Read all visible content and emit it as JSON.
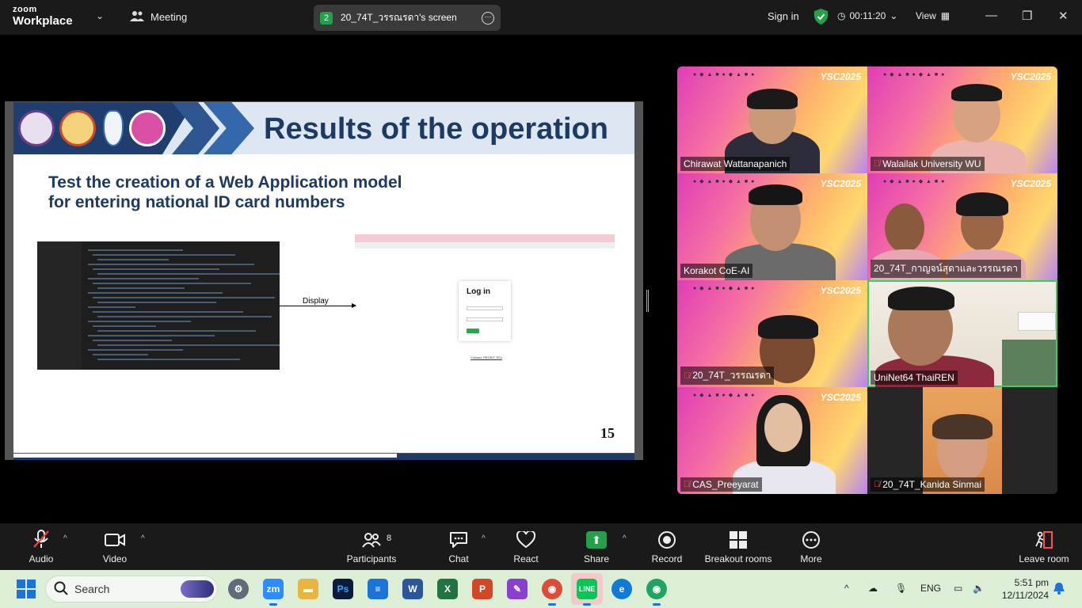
{
  "titlebar": {
    "logo_line1": "zoom",
    "logo_line2": "Workplace",
    "meeting_label": "Meeting",
    "share_number": "2",
    "share_label": "20_74T_วรรณรดา's screen",
    "sign_in": "Sign in",
    "timer": "00:11:20",
    "view": "View"
  },
  "slide": {
    "title": "Results of the operation",
    "subtitle_line1": "Test the creation of a Web Application model",
    "subtitle_line2": "for entering national ID card numbers",
    "display_label": "Display",
    "login_title": "Log in",
    "page_number": "15",
    "contact_text": "Contact: PROSIT TEU"
  },
  "participants_tiles": [
    {
      "name": "Chirawat Wattanapanich",
      "muted": false
    },
    {
      "name": "Walailak University WU",
      "muted": true
    },
    {
      "name": "Korakot CoE-AI",
      "muted": false
    },
    {
      "name": "20_74T_กาญจน์สุดาและวรรณรดา",
      "muted": false
    },
    {
      "name": "20_74T_วรรณรดา",
      "muted": true
    },
    {
      "name": "UniNet64 ThaiREN",
      "muted": false,
      "active": true
    },
    {
      "name": "CAS_Preeyarat",
      "muted": true
    },
    {
      "name": "20_74T_Kanida Sinmai",
      "muted": true
    }
  ],
  "tile_banner": {
    "badges": "● ◆ ▲ ■ ● ◆ ▲ ■ ●",
    "ysc": "YSC2025"
  },
  "toolbar": {
    "audio": "Audio",
    "video": "Video",
    "participants": "Participants",
    "participants_count": "8",
    "chat": "Chat",
    "react": "React",
    "share": "Share",
    "record": "Record",
    "breakout": "Breakout rooms",
    "more": "More",
    "leave": "Leave room"
  },
  "taskbar": {
    "search_label": "Search",
    "lang": "ENG",
    "time": "5:51 pm",
    "date": "12/11/2024"
  },
  "colors": {
    "accent_green": "#22a14a",
    "slide_title": "#1c3a63",
    "active_speaker": "#2fd35e"
  }
}
